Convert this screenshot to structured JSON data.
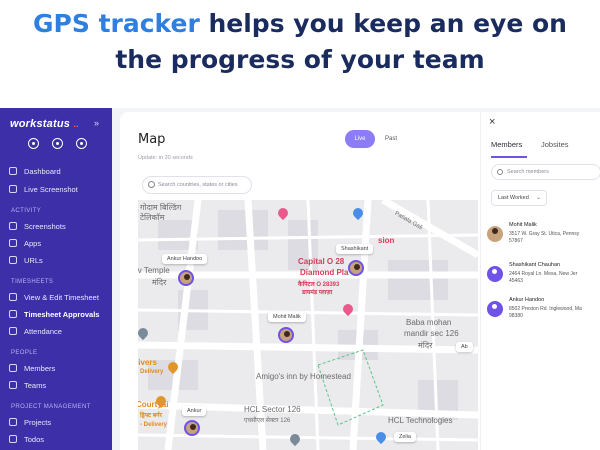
{
  "headline": {
    "accent": "GPS tracker",
    "rest_line1": " helps you keep an eye on",
    "line2": "the progress of your team"
  },
  "sidebar": {
    "brand": "workstatus",
    "brand_dots": "..",
    "collapse_icon": "»",
    "items": {
      "dashboard": "Dashboard",
      "live_screenshot": "Live Screenshot",
      "screenshots": "Screenshots",
      "apps": "Apps",
      "urls": "URLs",
      "view_edit_timesheet": "View & Edit Timesheet",
      "timesheet_approvals": "Timesheet Approvals",
      "attendance": "Attendance",
      "members": "Members",
      "teams": "Teams",
      "projects": "Projects",
      "todos": "Todos"
    },
    "sections": {
      "activity": "ACTIVITY",
      "timesheets": "TIMESHEETS",
      "people": "PEOPLE",
      "project_management": "PROJECT MANAGEMENT"
    }
  },
  "map_view": {
    "title": "Map",
    "updated": "Update: in 20 seconds",
    "toggle_live": "Live",
    "toggle_past": "Past",
    "search_placeholder": "Search countries, states or cities",
    "labels": {
      "hindi1": "गोदाम बिल्डिंग",
      "hindi1b": "टेलिकॉम",
      "temple": "iv Temple",
      "temple_hindi": "मंदिर",
      "capital": "Capital O 28",
      "diamond": "Diamond Pla",
      "diamond_hindi": "कैपिटल O 28393",
      "diamond_hindi2": "डायमंड प्लाज़ा",
      "sion": "sion",
      "gali": "Patiala Gali",
      "baba": "Baba mohan",
      "mandir": "mandir sec 126",
      "mandir_hindi": "मंदिर",
      "amigos": "Amigo's inn by Homestead",
      "hcl_sector": "HCL Sector 126",
      "hcl_hindi": "एचसीएल सेक्टर 126",
      "hcl_tech": "HCL Technologies",
      "divers": "livers",
      "delivery": "Delivery",
      "courtyard": "Courtyai",
      "delivery2": "- Delivery",
      "hindi_left": "ड्रिफ्ट बर्गर"
    },
    "tags": {
      "ankur": "Ankur Handoo",
      "shashikant": "Shashikant",
      "mohit": "Mohit Malik",
      "ankur2": "Ankur",
      "zelia": "Zelia",
      "right": "Ab"
    }
  },
  "panel": {
    "close_icon": "×",
    "tab_members": "Members",
    "tab_jobsites": "Jobsites",
    "search_placeholder": "Search members",
    "sort_label": "Last Worked",
    "sort_chevron": "⌄",
    "members": [
      {
        "name": "Mohit Malik",
        "address": "3517 W. Gray St. Utica, Pennsy",
        "zip": "57867"
      },
      {
        "name": "Shashikant Chauhan",
        "address": "2464 Royal Ln. Mesa, New Jer",
        "zip": "45463"
      },
      {
        "name": "Ankur Handoo",
        "address": "8502 Preston Rd. Inglewood, Ma",
        "zip": "98380"
      }
    ]
  },
  "colors": {
    "sidebar": "#3d2fa8",
    "accent": "#6f52e8",
    "headline_accent": "#2d7fe0",
    "headline": "#1a2b5e"
  }
}
